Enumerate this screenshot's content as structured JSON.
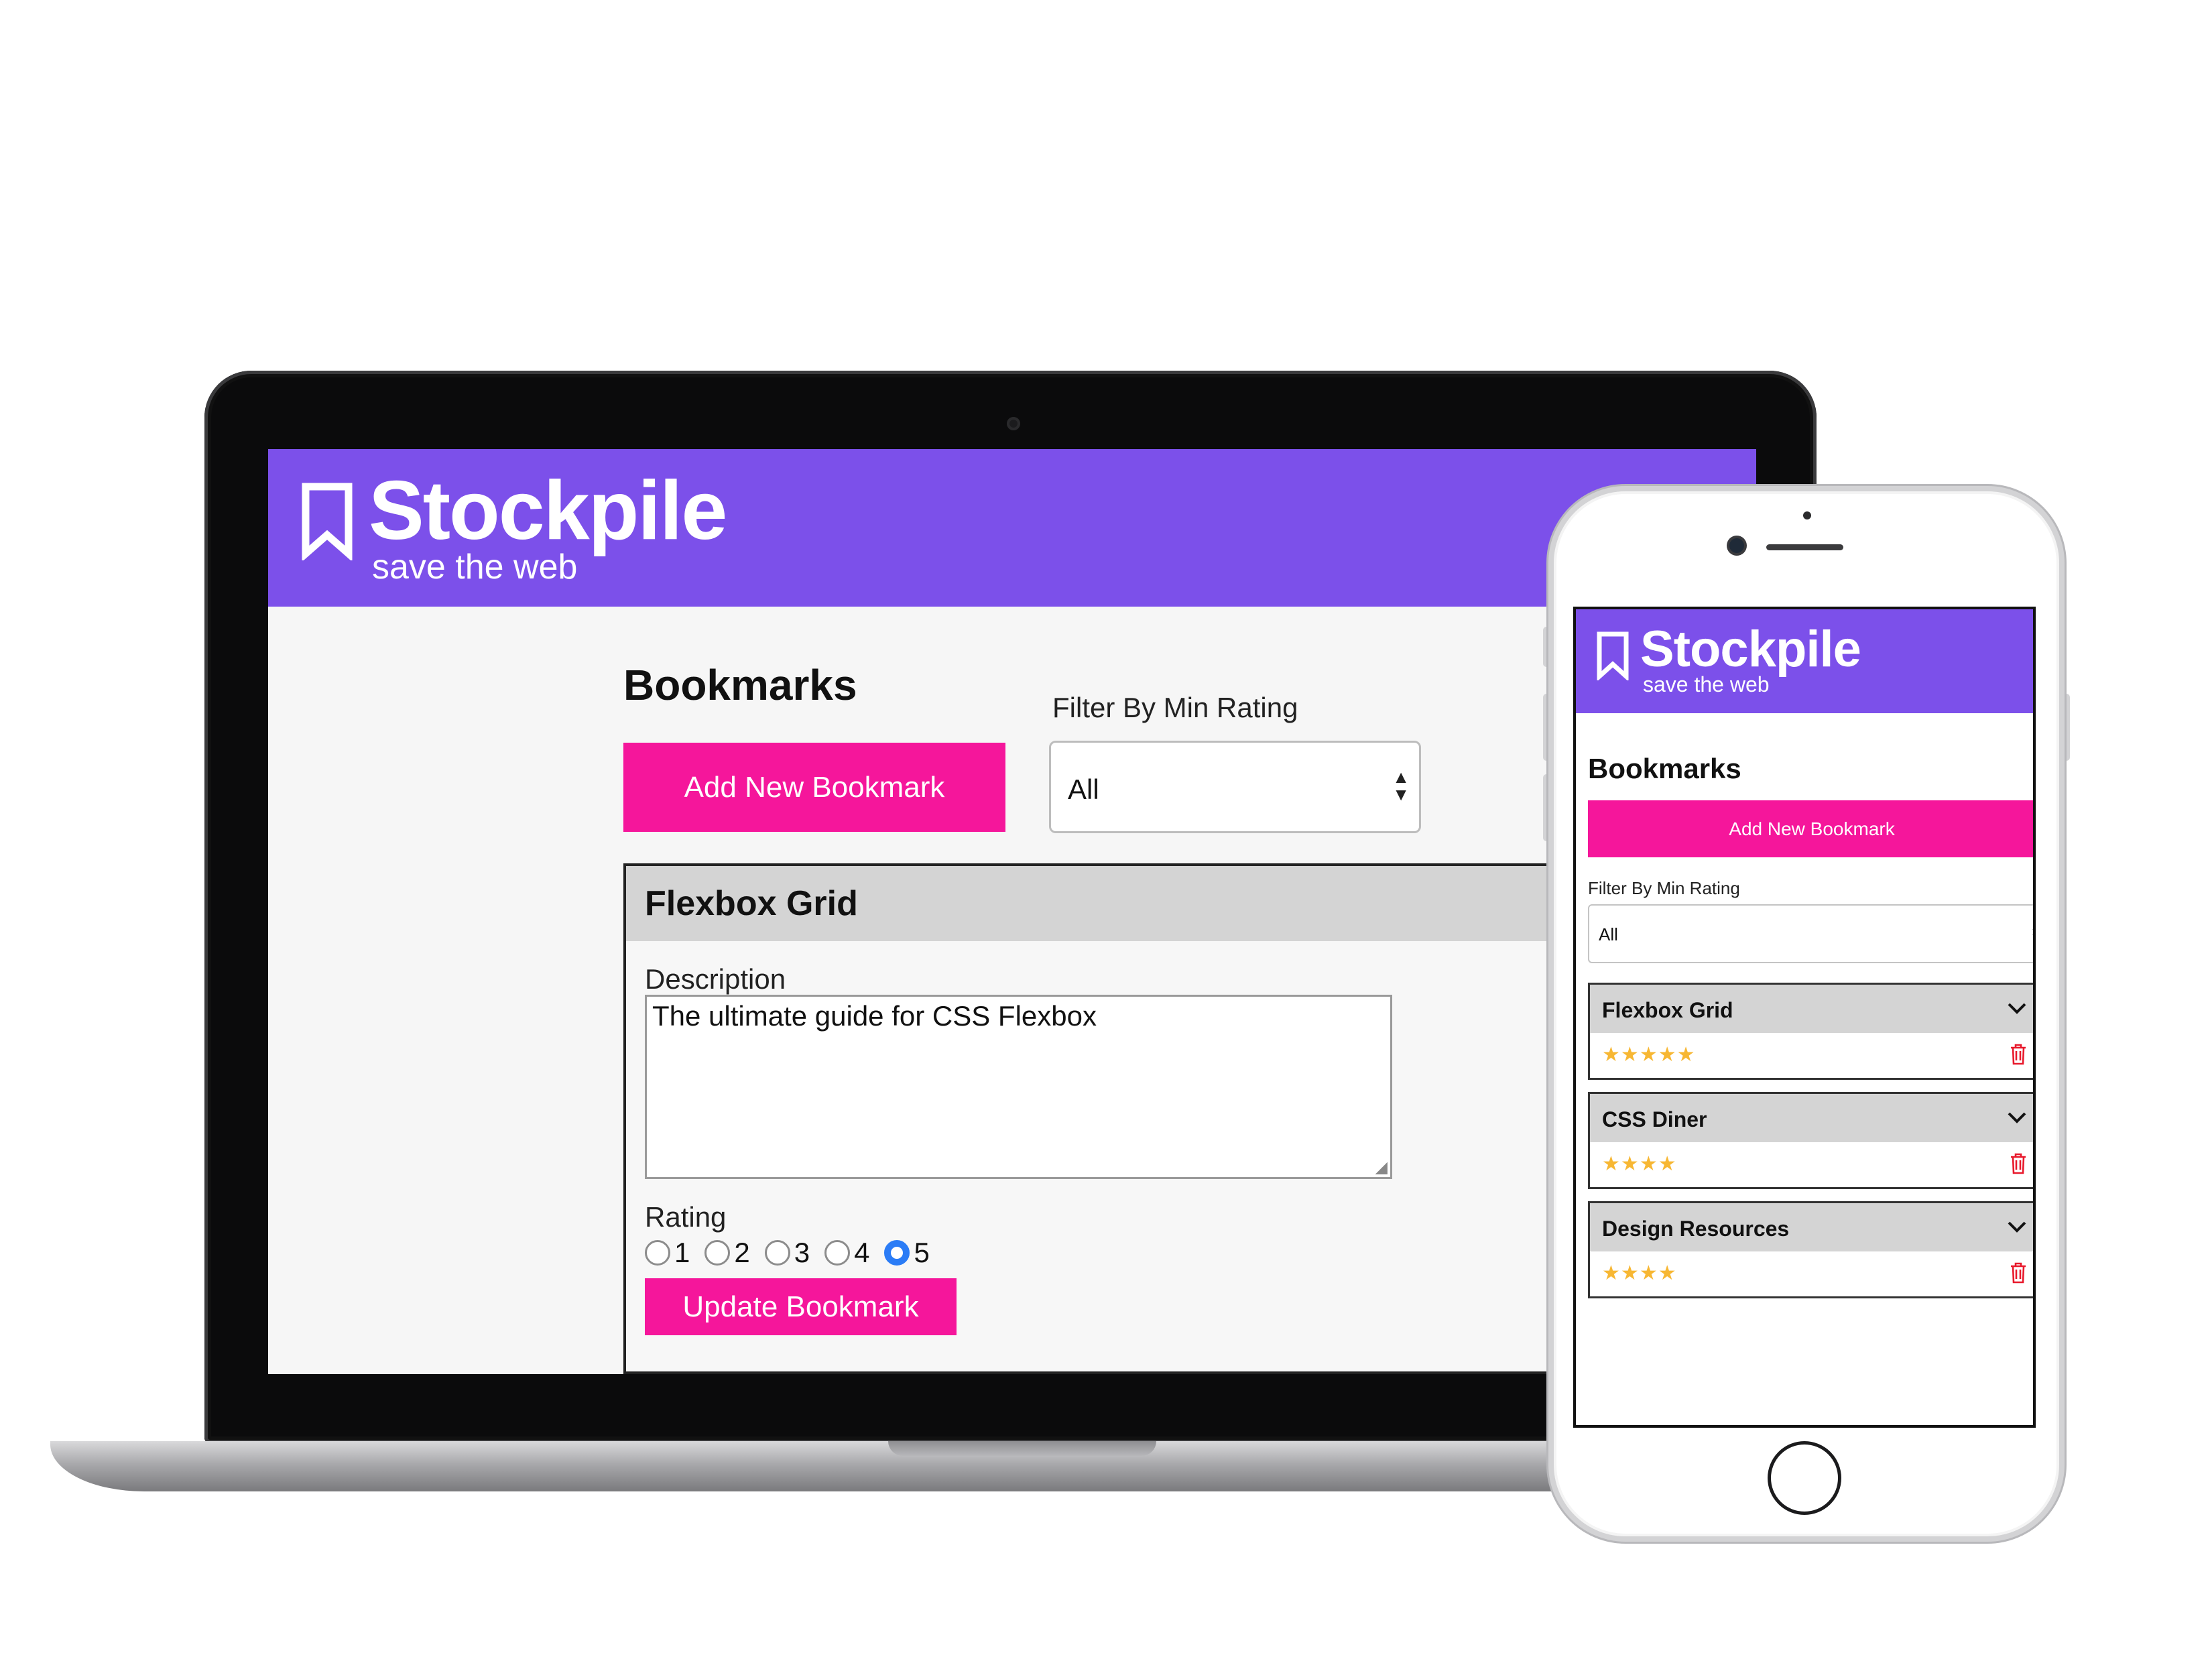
{
  "app": {
    "name": "Stockpile",
    "tagline": "save the web",
    "brand_color": "#7c50ea",
    "accent_color": "#f5169b"
  },
  "laptop": {
    "heading": "Bookmarks",
    "add_button": "Add New Bookmark",
    "filter_label": "Filter By Min Rating",
    "filter_value": "All",
    "bookmark": {
      "title": "Flexbox Grid",
      "description_label": "Description",
      "description": "The ultimate guide for CSS Flexbox",
      "rating_label": "Rating",
      "rating_options": [
        "1",
        "2",
        "3",
        "4",
        "5"
      ],
      "selected_rating": "5",
      "update_button": "Update Bookmark"
    }
  },
  "phone": {
    "heading": "Bookmarks",
    "add_button": "Add New Bookmark",
    "filter_label": "Filter By Min Rating",
    "filter_value": "All",
    "bookmarks": [
      {
        "title": "Flexbox Grid",
        "rating": 5
      },
      {
        "title": "CSS Diner",
        "rating": 4
      },
      {
        "title": "Design Resources",
        "rating": 4
      }
    ],
    "icons": {
      "expand": "chevron-down-icon",
      "delete": "trash-icon",
      "rating": "star-icon"
    }
  }
}
